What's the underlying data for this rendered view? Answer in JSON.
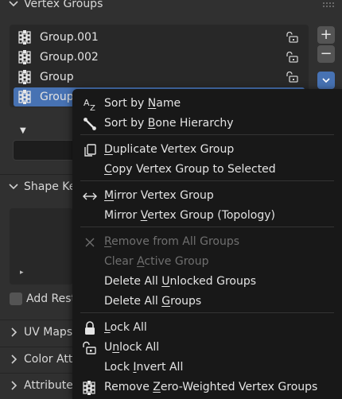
{
  "sections": {
    "vertex_groups": "Vertex Groups",
    "shape_keys": "Shape Ke",
    "uv_maps": "UV Maps",
    "color_attributes": "Color Attr",
    "attributes": "Attributes"
  },
  "vertex_groups": {
    "items": [
      {
        "label": "Group.001",
        "active": false
      },
      {
        "label": "Group.002",
        "active": false
      },
      {
        "label": "Group",
        "active": false
      },
      {
        "label": "Group",
        "active": true
      }
    ],
    "add_label": "+",
    "remove_label": "−",
    "specials_label": "⌄",
    "filter_toggle": "▼"
  },
  "shape_keys": {
    "expand_glyph": "▸"
  },
  "add_rest": "Add Rest",
  "context_menu": {
    "items": [
      {
        "label_pre": "Sort by ",
        "label_u": "N",
        "label_post": "ame",
        "icon": "sort-alpha-icon",
        "disabled": false
      },
      {
        "label_pre": "Sort by ",
        "label_u": "B",
        "label_post": "one Hierarchy",
        "icon": "bone-icon",
        "disabled": false
      },
      {
        "label_pre": "",
        "label_u": "D",
        "label_post": "uplicate Vertex Group",
        "icon": "duplicate-icon",
        "disabled": false
      },
      {
        "label_pre": "",
        "label_u": "C",
        "label_post": "opy Vertex Group to Selected",
        "icon": "",
        "disabled": false
      },
      {
        "label_pre": "",
        "label_u": "M",
        "label_post": "irror Vertex Group",
        "icon": "mirror-arrows-icon",
        "disabled": false
      },
      {
        "label_pre": "Mirror ",
        "label_u": "V",
        "label_post": "ertex Group (Topology)",
        "icon": "",
        "disabled": false
      },
      {
        "label_pre": "",
        "label_u": "R",
        "label_post": "emove from All Groups",
        "icon": "x-icon",
        "disabled": true
      },
      {
        "label_pre": "Clear ",
        "label_u": "A",
        "label_post": "ctive Group",
        "icon": "",
        "disabled": true
      },
      {
        "label_pre": "Delete All ",
        "label_u": "U",
        "label_post": "nlocked Groups",
        "icon": "",
        "disabled": false
      },
      {
        "label_pre": "Delete All ",
        "label_u": "G",
        "label_post": "roups",
        "icon": "",
        "disabled": false
      },
      {
        "label_pre": "",
        "label_u": "L",
        "label_post": "ock All",
        "icon": "lock-closed-icon",
        "disabled": false
      },
      {
        "label_pre": "U",
        "label_u": "n",
        "label_post": "lock All",
        "icon": "lock-open-icon",
        "disabled": false
      },
      {
        "label_pre": "Lock ",
        "label_u": "I",
        "label_post": "nvert All",
        "icon": "",
        "disabled": false
      },
      {
        "label_pre": "Remove ",
        "label_u": "Z",
        "label_post": "ero-Weighted Vertex Groups",
        "icon": "vertex-group-icon",
        "disabled": false
      }
    ]
  },
  "colors": {
    "panel": "#303030",
    "menu": "#181818",
    "accent": "#4772b3",
    "disabled_text": "#6f6f6f"
  }
}
